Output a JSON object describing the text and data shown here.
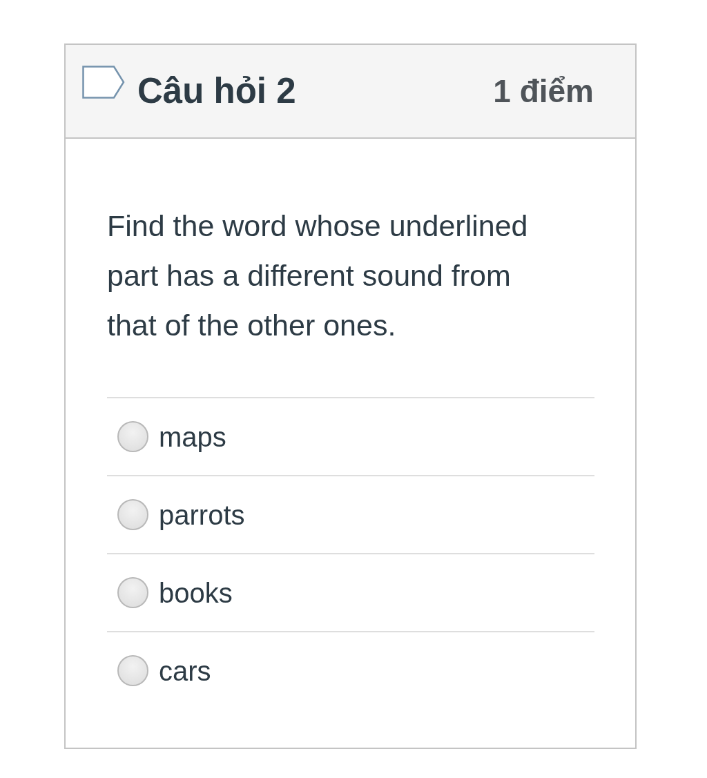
{
  "question": {
    "title": "Câu hỏi 2",
    "points": "1 điểm",
    "flagged": false,
    "text": "Find the word whose underlined part has a different sound from that of the other ones."
  },
  "options": [
    {
      "label": "maps",
      "selected": false
    },
    {
      "label": "parrots",
      "selected": false
    },
    {
      "label": "books",
      "selected": false
    },
    {
      "label": "cars",
      "selected": false
    }
  ]
}
